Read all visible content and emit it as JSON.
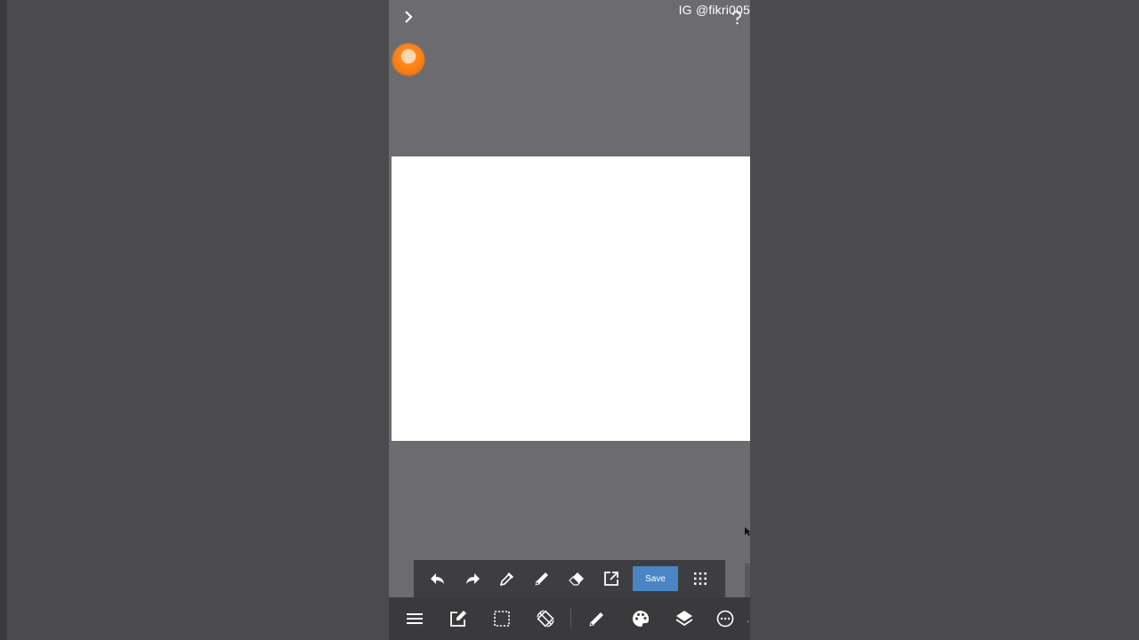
{
  "overlay": {
    "watermark": "IG @fikri005"
  },
  "header": {
    "expand_icon": "chevron-right-icon",
    "help_icon": "question-icon",
    "record_indicator": "record-dot"
  },
  "canvas": {
    "background": "#ffffff"
  },
  "toolbar": {
    "buttons": [
      "undo-icon",
      "redo-icon",
      "eyedropper-icon",
      "pencil-icon",
      "eraser-icon",
      "export-icon"
    ],
    "save_label": "Save",
    "grid_icon": "grid-icon",
    "accent": "#4a86c4"
  },
  "bottombar": {
    "buttons": [
      "menu-icon",
      "edit-icon",
      "selection-icon",
      "rotate-icon",
      "brush-icon",
      "palette-icon",
      "layers-icon",
      "more-icon"
    ],
    "more_label": "."
  }
}
